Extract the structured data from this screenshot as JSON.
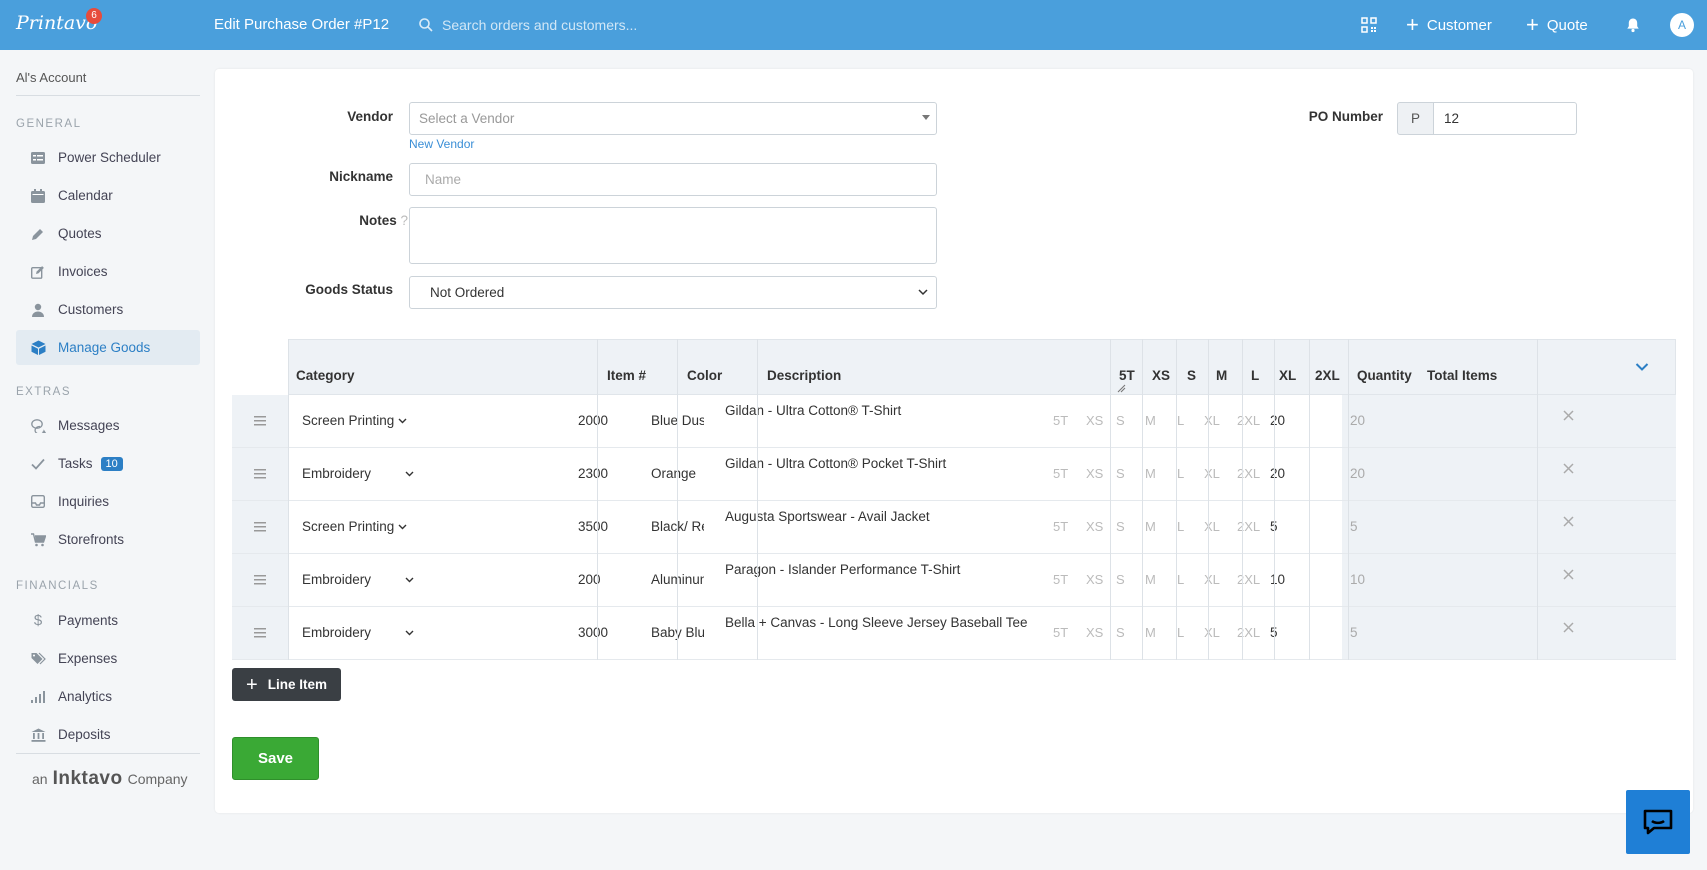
{
  "topbar": {
    "logo": "Printavo",
    "logo_badge": "6",
    "page_title": "Edit Purchase Order #P12",
    "search_placeholder": "Search orders and customers...",
    "customer_label": "Customer",
    "quote_label": "Quote",
    "avatar_initial": "A"
  },
  "sidebar": {
    "account": "Al's Account",
    "sections": {
      "general": "GENERAL",
      "extras": "EXTRAS",
      "financials": "FINANCIALS"
    },
    "general_items": [
      {
        "label": "Power Scheduler",
        "icon": "scheduler-icon"
      },
      {
        "label": "Calendar",
        "icon": "calendar-icon"
      },
      {
        "label": "Quotes",
        "icon": "pencil-icon"
      },
      {
        "label": "Invoices",
        "icon": "edit-icon"
      },
      {
        "label": "Customers",
        "icon": "user-icon"
      },
      {
        "label": "Manage Goods",
        "icon": "box-icon"
      }
    ],
    "extras_items": [
      {
        "label": "Messages",
        "icon": "messages-icon"
      },
      {
        "label": "Tasks",
        "icon": "check-icon",
        "badge": "10"
      },
      {
        "label": "Inquiries",
        "icon": "inbox-icon"
      },
      {
        "label": "Storefronts",
        "icon": "cart-icon"
      }
    ],
    "financials_items": [
      {
        "label": "Payments",
        "icon": "dollar-icon"
      },
      {
        "label": "Expenses",
        "icon": "tags-icon"
      },
      {
        "label": "Analytics",
        "icon": "signal-icon"
      },
      {
        "label": "Deposits",
        "icon": "bank-icon"
      }
    ],
    "footer_prefix": "an",
    "footer_brand": "Inktavo",
    "footer_suffix": "Company"
  },
  "form": {
    "vendor_label": "Vendor",
    "vendor_placeholder": "Select a Vendor",
    "new_vendor_link": "New Vendor",
    "nickname_label": "Nickname",
    "nickname_placeholder": "Name",
    "notes_label": "Notes",
    "notes_help": "?",
    "goods_status_label": "Goods Status",
    "goods_status_value": "Not Ordered",
    "po_number_label": "PO Number",
    "po_prefix": "P",
    "po_value": "12"
  },
  "table": {
    "headers": {
      "category": "Category",
      "item": "Item #",
      "color": "Color",
      "description": "Description",
      "s5t": "5T",
      "xs": "XS",
      "s": "S",
      "m": "M",
      "l": "L",
      "xl": "XL",
      "xxl": "2XL",
      "quantity": "Quantity",
      "total": "Total Items"
    },
    "size_placeholders": [
      "5T",
      "XS",
      "S",
      "M",
      "L",
      "XL",
      "2XL"
    ],
    "rows": [
      {
        "category": "Screen Printing",
        "item": "2000",
        "color": "Blue Dusk",
        "description": "Gildan - Ultra Cotton® T-Shirt",
        "quantity": "20",
        "total": "20"
      },
      {
        "category": "Embroidery",
        "item": "2300",
        "color": "Orange",
        "description": "Gildan - Ultra Cotton® Pocket T-Shirt",
        "quantity": "20",
        "total": "20"
      },
      {
        "category": "Screen Printing",
        "item": "3500",
        "color": "Black/ Red",
        "description": "Augusta Sportswear - Avail Jacket",
        "quantity": "5",
        "total": "5"
      },
      {
        "category": "Embroidery",
        "item": "200",
        "color": "Aluminum",
        "description": "Paragon - Islander Performance T-Shirt",
        "quantity": "10",
        "total": "10"
      },
      {
        "category": "Embroidery",
        "item": "3000",
        "color": "Baby Blue",
        "description": "Bella + Canvas - Long Sleeve Jersey Baseball Tee",
        "quantity": "5",
        "total": "5"
      }
    ]
  },
  "buttons": {
    "line_item": "Line Item",
    "save": "Save"
  },
  "colors": {
    "topbar": "#4a9fdc",
    "accent": "#2c7fc5",
    "save": "#3aa935",
    "badge": "#e74c3c"
  }
}
